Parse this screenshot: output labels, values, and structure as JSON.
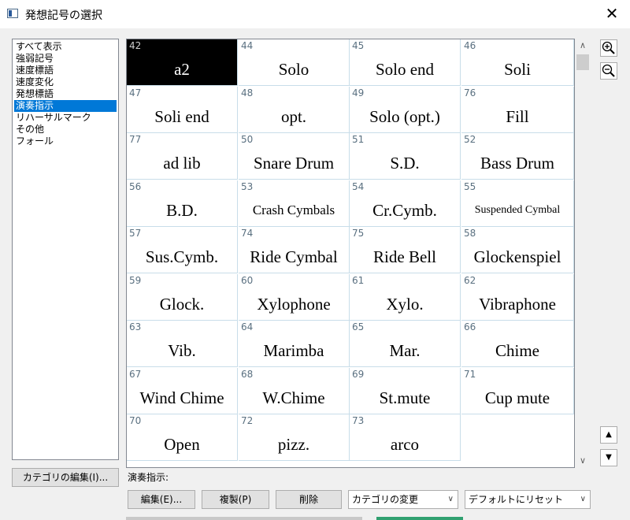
{
  "window": {
    "title": "発想記号の選択",
    "close_glyph": "✕"
  },
  "categories": [
    {
      "label": "すべて表示",
      "selected": false
    },
    {
      "label": "強弱記号",
      "selected": false
    },
    {
      "label": "速度標語",
      "selected": false
    },
    {
      "label": "速度変化",
      "selected": false
    },
    {
      "label": "発想標語",
      "selected": false
    },
    {
      "label": "演奏指示",
      "selected": true
    },
    {
      "label": "リハーサルマーク",
      "selected": false
    },
    {
      "label": "その他",
      "selected": false
    },
    {
      "label": "フォール",
      "selected": false
    }
  ],
  "symbols": [
    {
      "number": "42",
      "label": "a2",
      "selected": true
    },
    {
      "number": "44",
      "label": "Solo"
    },
    {
      "number": "45",
      "label": "Solo end"
    },
    {
      "number": "46",
      "label": "Soli"
    },
    {
      "number": "47",
      "label": "Soli end"
    },
    {
      "number": "48",
      "label": "opt."
    },
    {
      "number": "49",
      "label": "Solo (opt.)"
    },
    {
      "number": "76",
      "label": "Fill"
    },
    {
      "number": "77",
      "label": "ad lib"
    },
    {
      "number": "50",
      "label": "Snare Drum"
    },
    {
      "number": "51",
      "label": "S.D."
    },
    {
      "number": "52",
      "label": "Bass Drum"
    },
    {
      "number": "56",
      "label": "B.D."
    },
    {
      "number": "53",
      "label": "Crash Cymbals",
      "size": "small"
    },
    {
      "number": "54",
      "label": "Cr.Cymb."
    },
    {
      "number": "55",
      "label": "Suspended Cymbal",
      "size": "tiny"
    },
    {
      "number": "57",
      "label": "Sus.Cymb."
    },
    {
      "number": "74",
      "label": "Ride Cymbal"
    },
    {
      "number": "75",
      "label": "Ride Bell"
    },
    {
      "number": "58",
      "label": "Glockenspiel"
    },
    {
      "number": "59",
      "label": "Glock."
    },
    {
      "number": "60",
      "label": "Xylophone"
    },
    {
      "number": "61",
      "label": "Xylo."
    },
    {
      "number": "62",
      "label": "Vibraphone"
    },
    {
      "number": "63",
      "label": "Vib."
    },
    {
      "number": "64",
      "label": "Marimba"
    },
    {
      "number": "65",
      "label": "Mar."
    },
    {
      "number": "66",
      "label": "Chime"
    },
    {
      "number": "67",
      "label": "Wind Chime"
    },
    {
      "number": "68",
      "label": "W.Chime"
    },
    {
      "number": "69",
      "label": "St.mute"
    },
    {
      "number": "71",
      "label": "Cup mute"
    },
    {
      "number": "70",
      "label": "Open"
    },
    {
      "number": "72",
      "label": "pizz."
    },
    {
      "number": "73",
      "label": "arco"
    }
  ],
  "grid_columns": 4,
  "buttons": {
    "edit_categories": "カテゴリの編集(I)...",
    "edit": "編集(E)...",
    "duplicate": "複製(P)",
    "delete": "削除"
  },
  "section_label": "演奏指示:",
  "combos": {
    "change_category": "カテゴリの変更",
    "reset_default": "デフォルトにリセット"
  },
  "icons": {
    "zoom_in": "zoom-in-icon",
    "zoom_out": "zoom-out-icon",
    "scroll_up": "▲",
    "scroll_down": "▼",
    "arrow_up": "∧",
    "arrow_down": "∨"
  }
}
